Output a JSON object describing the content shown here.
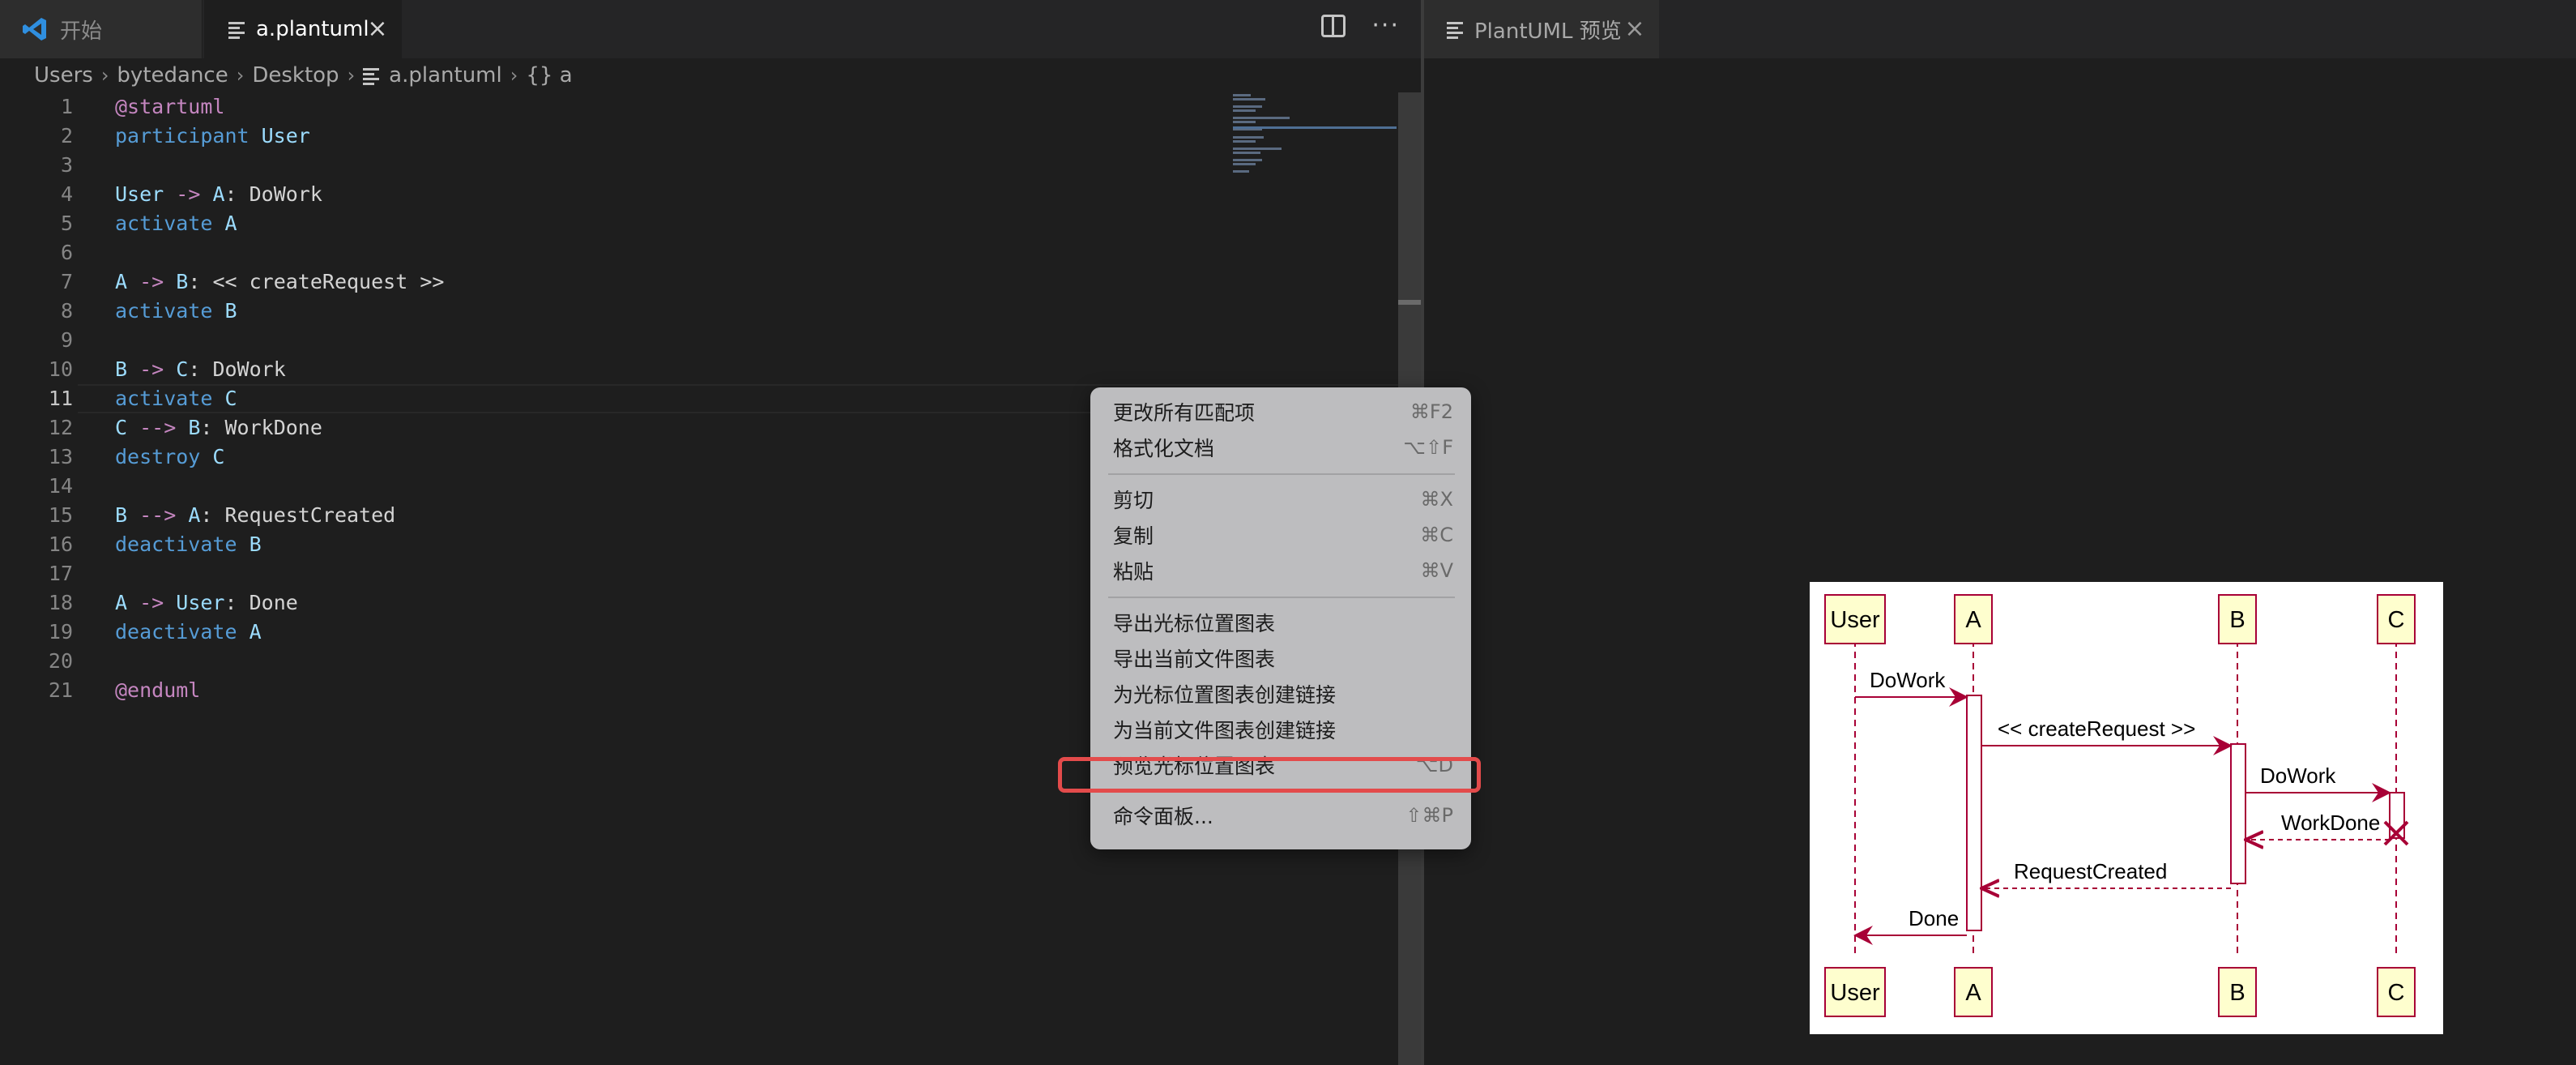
{
  "editor": {
    "tabs": [
      {
        "label": "开始"
      },
      {
        "label": "a.plantuml"
      }
    ],
    "breadcrumb": [
      "Users",
      "bytedance",
      "Desktop",
      "a.plantuml",
      "{} a"
    ],
    "current_line": 11,
    "line_numbers": [
      "1",
      "2",
      "3",
      "4",
      "5",
      "6",
      "7",
      "8",
      "9",
      "10",
      "11",
      "12",
      "13",
      "14",
      "15",
      "16",
      "17",
      "18",
      "19",
      "20",
      "21"
    ]
  },
  "preview": {
    "tab_label": "PlantUML 预览",
    "diagram": {
      "participants": [
        "User",
        "A",
        "B",
        "C"
      ],
      "messages": [
        "DoWork",
        "<< createRequest >>",
        "DoWork",
        "WorkDone",
        "RequestCreated",
        "Done"
      ]
    }
  },
  "context_menu": {
    "items": [
      {
        "label": "更改所有匹配项",
        "shortcut": "⌘F2"
      },
      {
        "label": "格式化文档",
        "shortcut": "⌥⇧F"
      },
      {
        "label": "剪切",
        "shortcut": "⌘X"
      },
      {
        "label": "复制",
        "shortcut": "⌘C"
      },
      {
        "label": "粘贴",
        "shortcut": "⌘V"
      },
      {
        "label": "导出光标位置图表",
        "shortcut": ""
      },
      {
        "label": "导出当前文件图表",
        "shortcut": ""
      },
      {
        "label": "为光标位置图表创建链接",
        "shortcut": ""
      },
      {
        "label": "为当前文件图表创建链接",
        "shortcut": ""
      },
      {
        "label": "预览光标位置图表",
        "shortcut": "⌥D"
      },
      {
        "label": "命令面板...",
        "shortcut": "⇧⌘P"
      }
    ],
    "highlighted_index": 9
  },
  "colors": {
    "accent_highlight": "#e34b4b",
    "seq_arrow": "#a80036",
    "lifeline_fill": "#fefece"
  },
  "icons": [
    "vscode-icon",
    "file-lines-icon",
    "close-icon",
    "split-editor-icon",
    "more-actions-icon"
  ]
}
